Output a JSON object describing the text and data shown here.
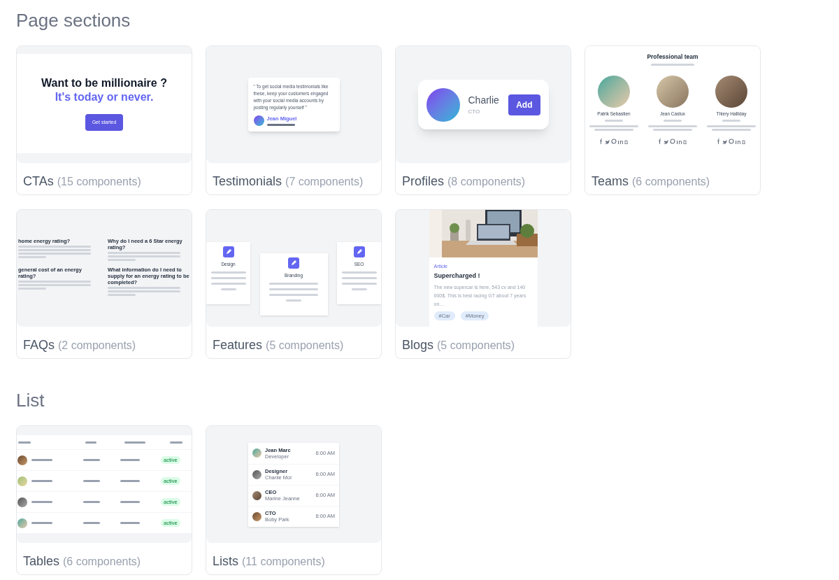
{
  "sections": [
    {
      "title": "Page sections",
      "cards": [
        {
          "name": "CTAs",
          "count": "(15 components)",
          "preview": {
            "kind": "cta",
            "title": "Want to be millionaire ?",
            "subtitle": "It's today or never.",
            "button": "Get started"
          }
        },
        {
          "name": "Testimonials",
          "count": "(7 components)",
          "preview": {
            "kind": "testimonial",
            "quote": "“ To get social media testimonials like these, keep your customers engaged with your social media accounts by posting regularly yourself ”",
            "author": "Jean Miguel"
          }
        },
        {
          "name": "Profiles",
          "count": "(8 components)",
          "preview": {
            "kind": "profile",
            "person": "Charlie",
            "role": "CTO",
            "button": "Add"
          }
        },
        {
          "name": "Teams",
          "count": "(6 components)",
          "preview": {
            "kind": "team",
            "title": "Professional team",
            "members": [
              "Patrik Sebastien",
              "Jean Castux",
              "Thiery Halliday"
            ]
          }
        },
        {
          "name": "FAQs",
          "count": "(2 components)",
          "preview": {
            "kind": "faq",
            "questions": [
              "home energy rating?",
              "Why do I need a 6 Star energy rating?",
              "general cost of an energy rating?",
              "What information do I need to supply for an energy rating to be completed?"
            ]
          }
        },
        {
          "name": "Features",
          "count": "(5 components)",
          "preview": {
            "kind": "features",
            "items": [
              "Design",
              "Branding",
              "SEO"
            ]
          }
        },
        {
          "name": "Blogs",
          "count": "(5 components)",
          "preview": {
            "kind": "blog",
            "category": "Article",
            "title": "Supercharged !",
            "text": "The new supercar is here, 543 cv and 140 000$. This is best racing GT about 7 years on...",
            "tags": [
              "#Car",
              "#Money"
            ]
          }
        }
      ]
    },
    {
      "title": "List",
      "cards": [
        {
          "name": "Tables",
          "count": "(6 components)",
          "preview": {
            "kind": "table",
            "rows": [
              {
                "badge": "active"
              },
              {
                "badge": "active"
              },
              {
                "badge": "active"
              },
              {
                "badge": "active"
              }
            ]
          }
        },
        {
          "name": "Lists",
          "count": "(11 components)",
          "preview": {
            "kind": "list",
            "items": [
              {
                "title": "Jean Marc",
                "subtitle": "Developer",
                "time": "6:00 AM"
              },
              {
                "title": "Designer",
                "subtitle": "Charlie Moi",
                "time": "6:00 AM"
              },
              {
                "title": "CEO",
                "subtitle": "Marine Jeanne",
                "time": "6:00 AM"
              },
              {
                "title": "CTO",
                "subtitle": "Boby Park",
                "time": "6:00 AM"
              }
            ]
          }
        }
      ]
    }
  ]
}
